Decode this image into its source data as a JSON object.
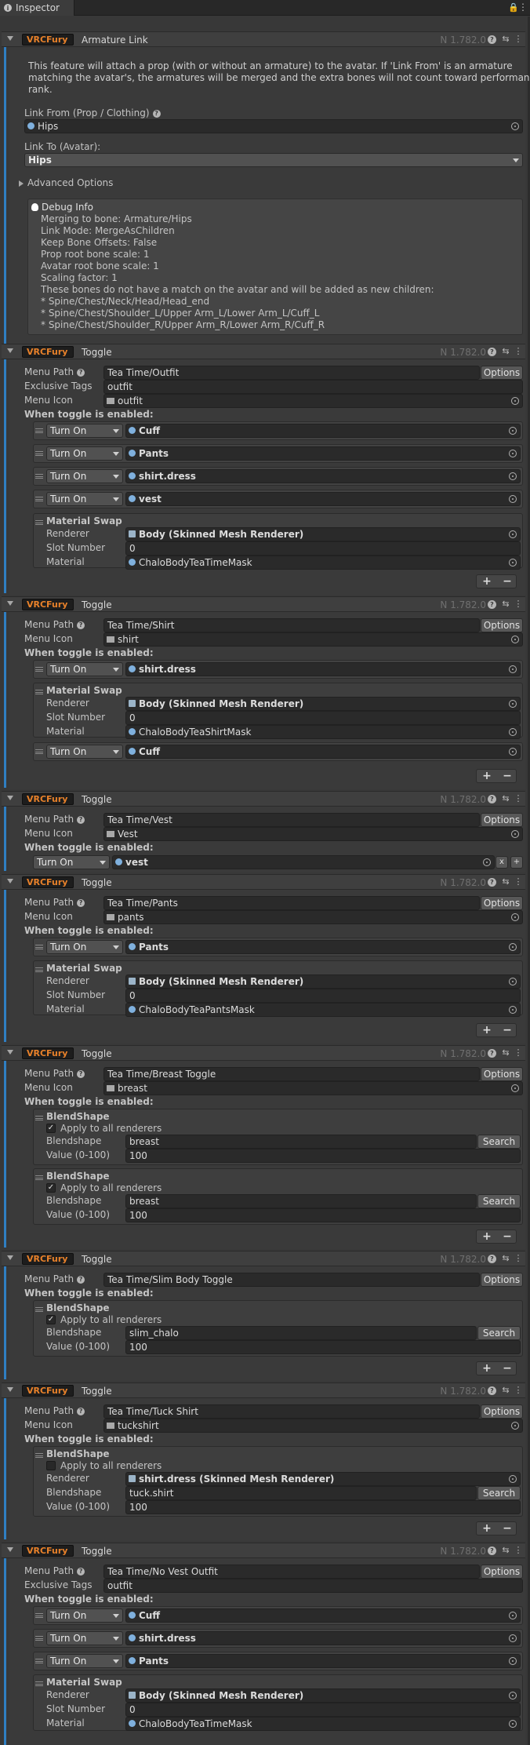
{
  "tab": {
    "title": "Inspector"
  },
  "common": {
    "brand": "VRCFury",
    "version": "N 1.782.0",
    "turn_on": "Turn On",
    "options": "Options",
    "search": "Search",
    "when_enabled": "When toggle is enabled:",
    "menu_path": "Menu Path",
    "menu_icon": "Menu Icon",
    "exclusive_tags": "Exclusive Tags",
    "material_swap": "Material Swap",
    "renderer": "Renderer",
    "slot_number": "Slot Number",
    "material": "Material",
    "blendshape_title": "BlendShape",
    "apply_all": "Apply to all renderers",
    "blendshape": "Blendshape",
    "value": "Value (0-100)",
    "add": "+",
    "remove": "−",
    "x": "x"
  },
  "armature": {
    "title": "Armature Link",
    "description": "This feature will attach a prop (with or without an armature) to the avatar. If 'Link From' is an armature matching the avatar's, the armatures will be merged and the extra bones will not count toward performance rank.",
    "desc_line1": "This feature will attach a prop (with or without an armature) to the avatar. If 'Link From' is an armature",
    "desc_line2": "matching the avatar's, the armatures will be merged and the extra bones will not count toward performance",
    "desc_line3": "rank.",
    "link_from_label": "Link From (Prop / Clothing)",
    "link_from_value": "Hips",
    "link_to_label": "Link To (Avatar):",
    "link_to_value": "Hips",
    "advanced": "Advanced Options",
    "debug_title": "Debug Info",
    "debug_lines": [
      "Merging to bone: Armature/Hips",
      "Link Mode: MergeAsChildren",
      "Keep Bone Offsets: False",
      "Prop root bone scale: 1",
      "Avatar root bone scale: 1",
      "Scaling factor: 1",
      "These bones do not have a match on the avatar and will be added as new children:",
      "* Spine/Chest/Neck/Head/Head_end",
      "* Spine/Chest/Shoulder_L/Upper Arm_L/Lower Arm_L/Cuff_L",
      "* Spine/Chest/Shoulder_R/Upper Arm_R/Lower Arm_R/Cuff_R"
    ]
  },
  "toggles": [
    {
      "title": "Toggle",
      "menu_path": "Tea Time/Outfit",
      "exclusive": "outfit",
      "icon": "outfit",
      "actions": [
        "Cuff",
        "Pants",
        "shirt.dress",
        "vest"
      ],
      "swap": {
        "renderer": "Body (Skinned Mesh Renderer)",
        "slot": "0",
        "material": "ChaloBodyTeaTimeMask"
      }
    },
    {
      "title": "Toggle",
      "menu_path": "Tea Time/Shirt",
      "icon": "shirt",
      "actions": [
        "shirt.dress",
        "Cuff"
      ],
      "swap": {
        "renderer": "Body (Skinned Mesh Renderer)",
        "slot": "0",
        "material": "ChaloBodyTeaShirtMask"
      }
    },
    {
      "title": "Toggle",
      "menu_path": "Tea Time/Vest",
      "icon": "Vest",
      "actions": [
        "vest"
      ]
    },
    {
      "title": "Toggle",
      "menu_path": "Tea Time/Pants",
      "icon": "pants",
      "actions": [
        "Pants"
      ],
      "swap": {
        "renderer": "Body (Skinned Mesh Renderer)",
        "slot": "0",
        "material": "ChaloBodyTeaPantsMask"
      }
    },
    {
      "title": "Toggle",
      "menu_path": "Tea Time/Breast Toggle",
      "icon": "breast",
      "blendshapes": [
        {
          "name": "breast",
          "value": "100"
        },
        {
          "name": "breast",
          "value": "100"
        }
      ]
    },
    {
      "title": "Toggle",
      "menu_path": "Tea Time/Slim Body Toggle",
      "blendshapes": [
        {
          "name": "slim_chalo",
          "value": "100"
        }
      ]
    },
    {
      "title": "Toggle",
      "menu_path": "Tea Time/Tuck Shirt",
      "icon": "tuckshirt",
      "blendshape": {
        "renderer": "shirt.dress (Skinned Mesh Renderer)",
        "name": "tuck.shirt",
        "value": "100"
      }
    },
    {
      "title": "Toggle",
      "menu_path": "Tea Time/No Vest Outfit",
      "exclusive": "outfit",
      "actions": [
        "Cuff",
        "shirt.dress",
        "Pants"
      ],
      "swap": {
        "renderer": "Body (Skinned Mesh Renderer)",
        "slot": "0",
        "material": "ChaloBodyTeaTimeMask"
      }
    }
  ]
}
